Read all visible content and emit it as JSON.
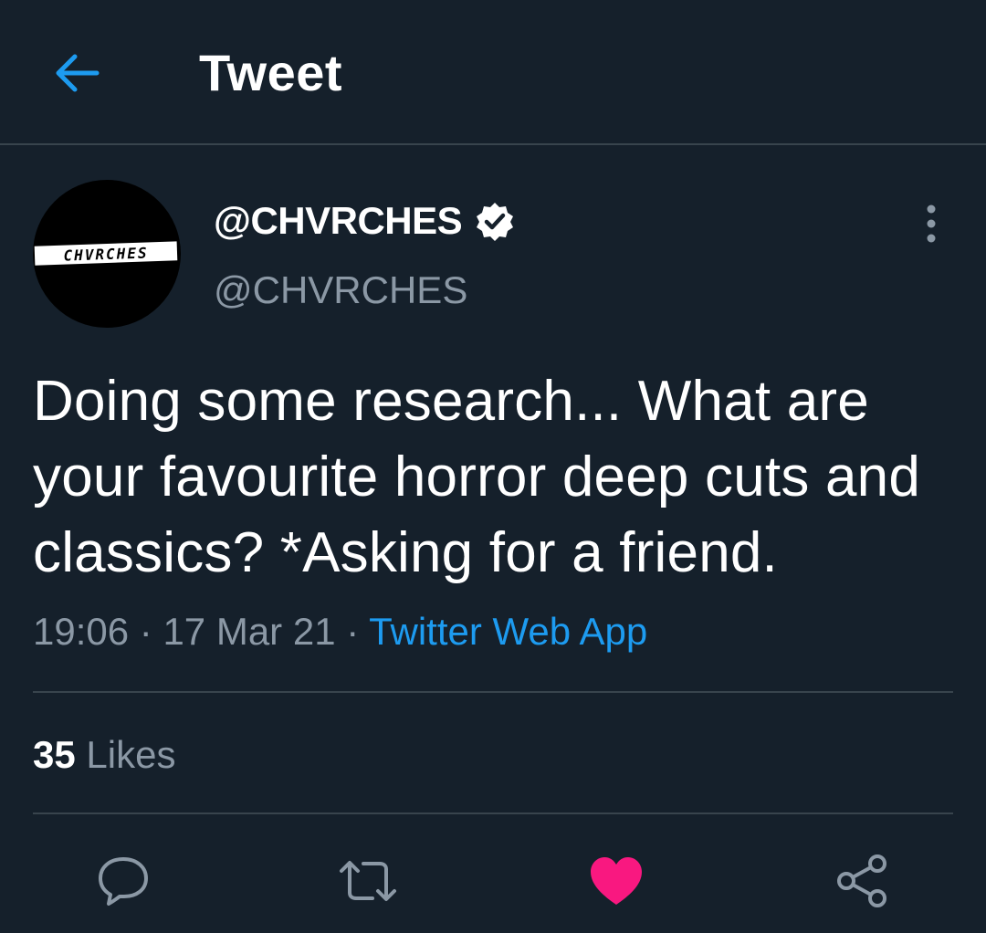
{
  "header": {
    "title": "Tweet",
    "back_icon": "arrow-left-icon",
    "accent_color": "#1d9bf0"
  },
  "author": {
    "display_name": "@CHVRCHES",
    "handle": "@CHVRCHES",
    "verified": true,
    "avatar_logo_text": "CHVRCHES"
  },
  "tweet": {
    "text": "Doing some research... What are your favourite horror deep cuts and classics? *Asking for a friend.",
    "time": "19:06",
    "date": "17 Mar 21",
    "separator": "·",
    "source": "Twitter Web App"
  },
  "stats": {
    "likes_count": "35",
    "likes_label": "Likes"
  },
  "actions": [
    {
      "name": "reply",
      "icon": "speech-bubble-icon"
    },
    {
      "name": "retweet",
      "icon": "retweet-icon"
    },
    {
      "name": "like",
      "icon": "heart-icon",
      "active": true,
      "color": "#f91880"
    },
    {
      "name": "share",
      "icon": "share-icon"
    }
  ],
  "theme": {
    "background": "#15202b",
    "secondary_text": "#8b98a5",
    "divider": "#38444d"
  }
}
